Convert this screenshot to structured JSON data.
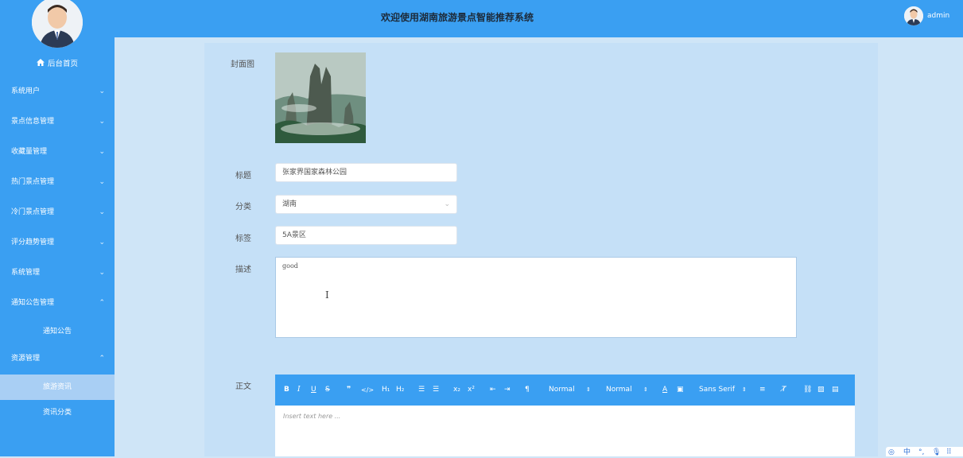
{
  "header": {
    "title": "欢迎使用湖南旅游景点智能推荐系统",
    "username": "admin"
  },
  "sidebar": {
    "home_label": "后台首页",
    "items": [
      {
        "label": "系统用户"
      },
      {
        "label": "景点信息管理"
      },
      {
        "label": "收藏量管理"
      },
      {
        "label": "热门景点管理"
      },
      {
        "label": "冷门景点管理"
      },
      {
        "label": "评分趋势管理"
      },
      {
        "label": "系统管理"
      },
      {
        "label": "通知公告管理"
      },
      {
        "label": "资源管理"
      }
    ],
    "sub_notice": "通知公告",
    "sub_resource": [
      "旅游资讯",
      "资讯分类"
    ]
  },
  "form": {
    "cover_label": "封面图",
    "title_label": "标题",
    "title_value": "张家界国家森林公园",
    "category_label": "分类",
    "category_value": "湖南",
    "tag_label": "标签",
    "tag_value": "5A景区",
    "desc_label": "描述",
    "desc_value": "good",
    "body_label": "正文",
    "editor_placeholder": "Insert text here ...",
    "toolbar": {
      "header_size": "Normal",
      "font_size": "Normal",
      "font_family": "Sans Serif"
    }
  },
  "ime": {
    "mode": "中"
  },
  "colors": {
    "primary": "#3a9ff2",
    "background": "#cfe5f7",
    "active_submenu": "#a9cff4"
  }
}
